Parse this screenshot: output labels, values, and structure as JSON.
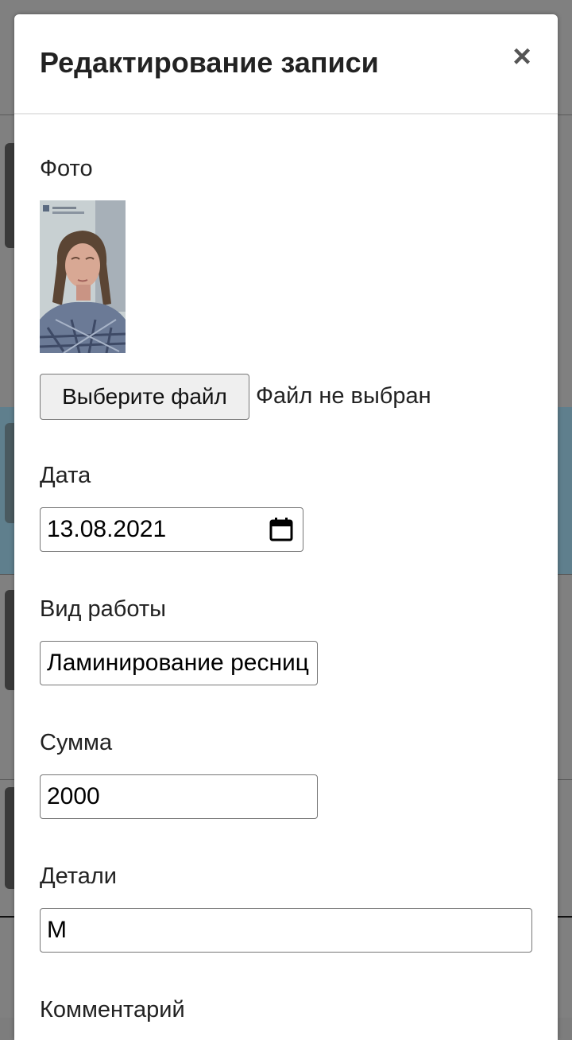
{
  "modal": {
    "title": "Редактирование записи",
    "close_glyph": "×"
  },
  "form": {
    "photo_label": "Фото",
    "photo_alt": "Фото",
    "file_button_label": "Выберите файл",
    "file_status": "Файл не выбран",
    "date_label": "Дата",
    "date_value": "13.08.2021",
    "work_type_label": "Вид работы",
    "work_type_value": "Ламинирование ресниц",
    "amount_label": "Сумма",
    "amount_value": "2000",
    "details_label": "Детали",
    "details_value": "М",
    "comment_label": "Комментарий"
  },
  "icons": {
    "close": "close-icon",
    "calendar": "calendar-icon"
  }
}
